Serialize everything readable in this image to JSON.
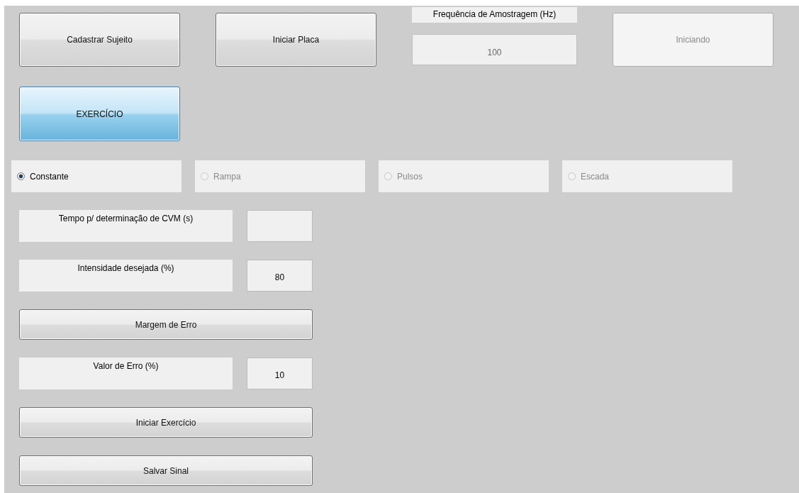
{
  "top_row": [
    {
      "kind": "button",
      "label": "Cadastrar Sujeito",
      "disabled": false
    },
    {
      "kind": "button",
      "label": "Iniciar Placa",
      "disabled": false
    },
    {
      "kind": "field",
      "label": "Frequência de Amostragem (Hz)",
      "value": "100"
    },
    {
      "kind": "button",
      "label": "Iniciando",
      "disabled": true
    }
  ],
  "exercise_toggle": {
    "label": "EXERCÍCIO",
    "selected": true
  },
  "profile_options": [
    {
      "label": "Constante",
      "selected": true,
      "disabled": false
    },
    {
      "label": "Rampa",
      "selected": false,
      "disabled": true
    },
    {
      "label": "Pulsos",
      "selected": false,
      "disabled": true
    },
    {
      "label": "Escada",
      "selected": false,
      "disabled": true
    }
  ],
  "form": [
    {
      "kind": "labeled_field",
      "label": "Tempo p/ determinação de CVM (s)"
    },
    {
      "kind": "labeled_field",
      "label": "Intensidade desejada (%)",
      "value": "80"
    },
    {
      "kind": "button",
      "label": "Margem de Erro"
    },
    {
      "kind": "labeled_field",
      "label": "Valor de Erro (%)",
      "value": "10"
    },
    {
      "kind": "button",
      "label": "Iniciar Exercício"
    },
    {
      "kind": "button",
      "label": "Salvar Sinal"
    }
  ]
}
